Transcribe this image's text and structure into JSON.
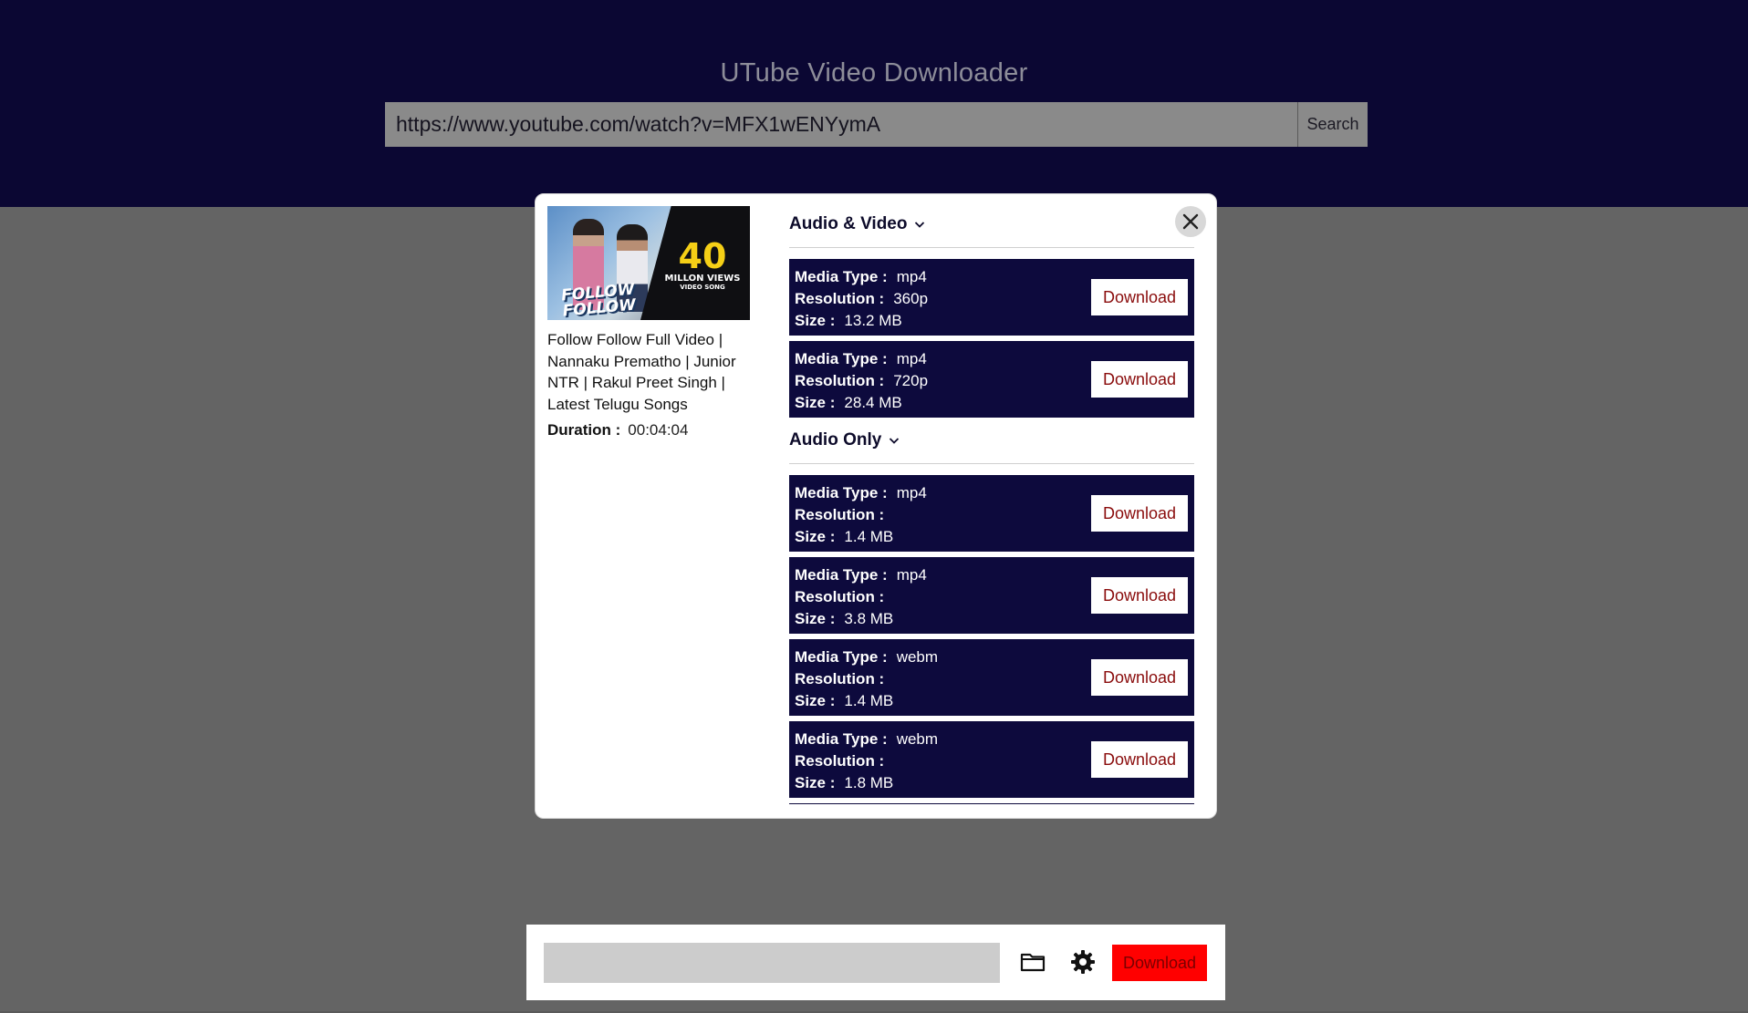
{
  "header": {
    "title": "UTube Video Downloader",
    "url_value": "https://www.youtube.com/watch?v=MFX1wENYymA",
    "search_label": "Search"
  },
  "video": {
    "thumbnail": {
      "views_number": "40",
      "views_text": "MILLON VIEWS",
      "views_sub": "VIDEO SONG",
      "title_line1": "FOLLOW",
      "title_line2": "FOLLOW"
    },
    "title": "Follow Follow Full Video | Nannaku Prematho | Junior NTR | Rakul Preet Singh | Latest Telugu Songs",
    "duration_label": "Duration :",
    "duration_value": "00:04:04"
  },
  "labels": {
    "media_type": "Media Type :",
    "resolution": "Resolution :",
    "size": "Size :",
    "download": "Download"
  },
  "sections": [
    {
      "title": "Audio & Video",
      "formats": [
        {
          "media_type": "mp4",
          "resolution": "360p",
          "size": "13.2 MB"
        },
        {
          "media_type": "mp4",
          "resolution": "720p",
          "size": "28.4 MB"
        }
      ]
    },
    {
      "title": "Audio Only",
      "formats": [
        {
          "media_type": "mp4",
          "resolution": "",
          "size": "1.4 MB"
        },
        {
          "media_type": "mp4",
          "resolution": "",
          "size": "3.8 MB"
        },
        {
          "media_type": "webm",
          "resolution": "",
          "size": "1.4 MB"
        },
        {
          "media_type": "webm",
          "resolution": "",
          "size": "1.8 MB"
        }
      ]
    }
  ],
  "bottom_bar": {
    "path_value": "",
    "download_label": "Download"
  },
  "colors": {
    "header_bg": "#0b0733",
    "card_bg": "#0d0a3d",
    "download_red": "#ff0000",
    "page_bg": "#646464"
  },
  "icons": {
    "close": "close-icon",
    "chevron": "chevron-down-icon",
    "folder": "folder-icon",
    "settings": "gear-icon"
  }
}
